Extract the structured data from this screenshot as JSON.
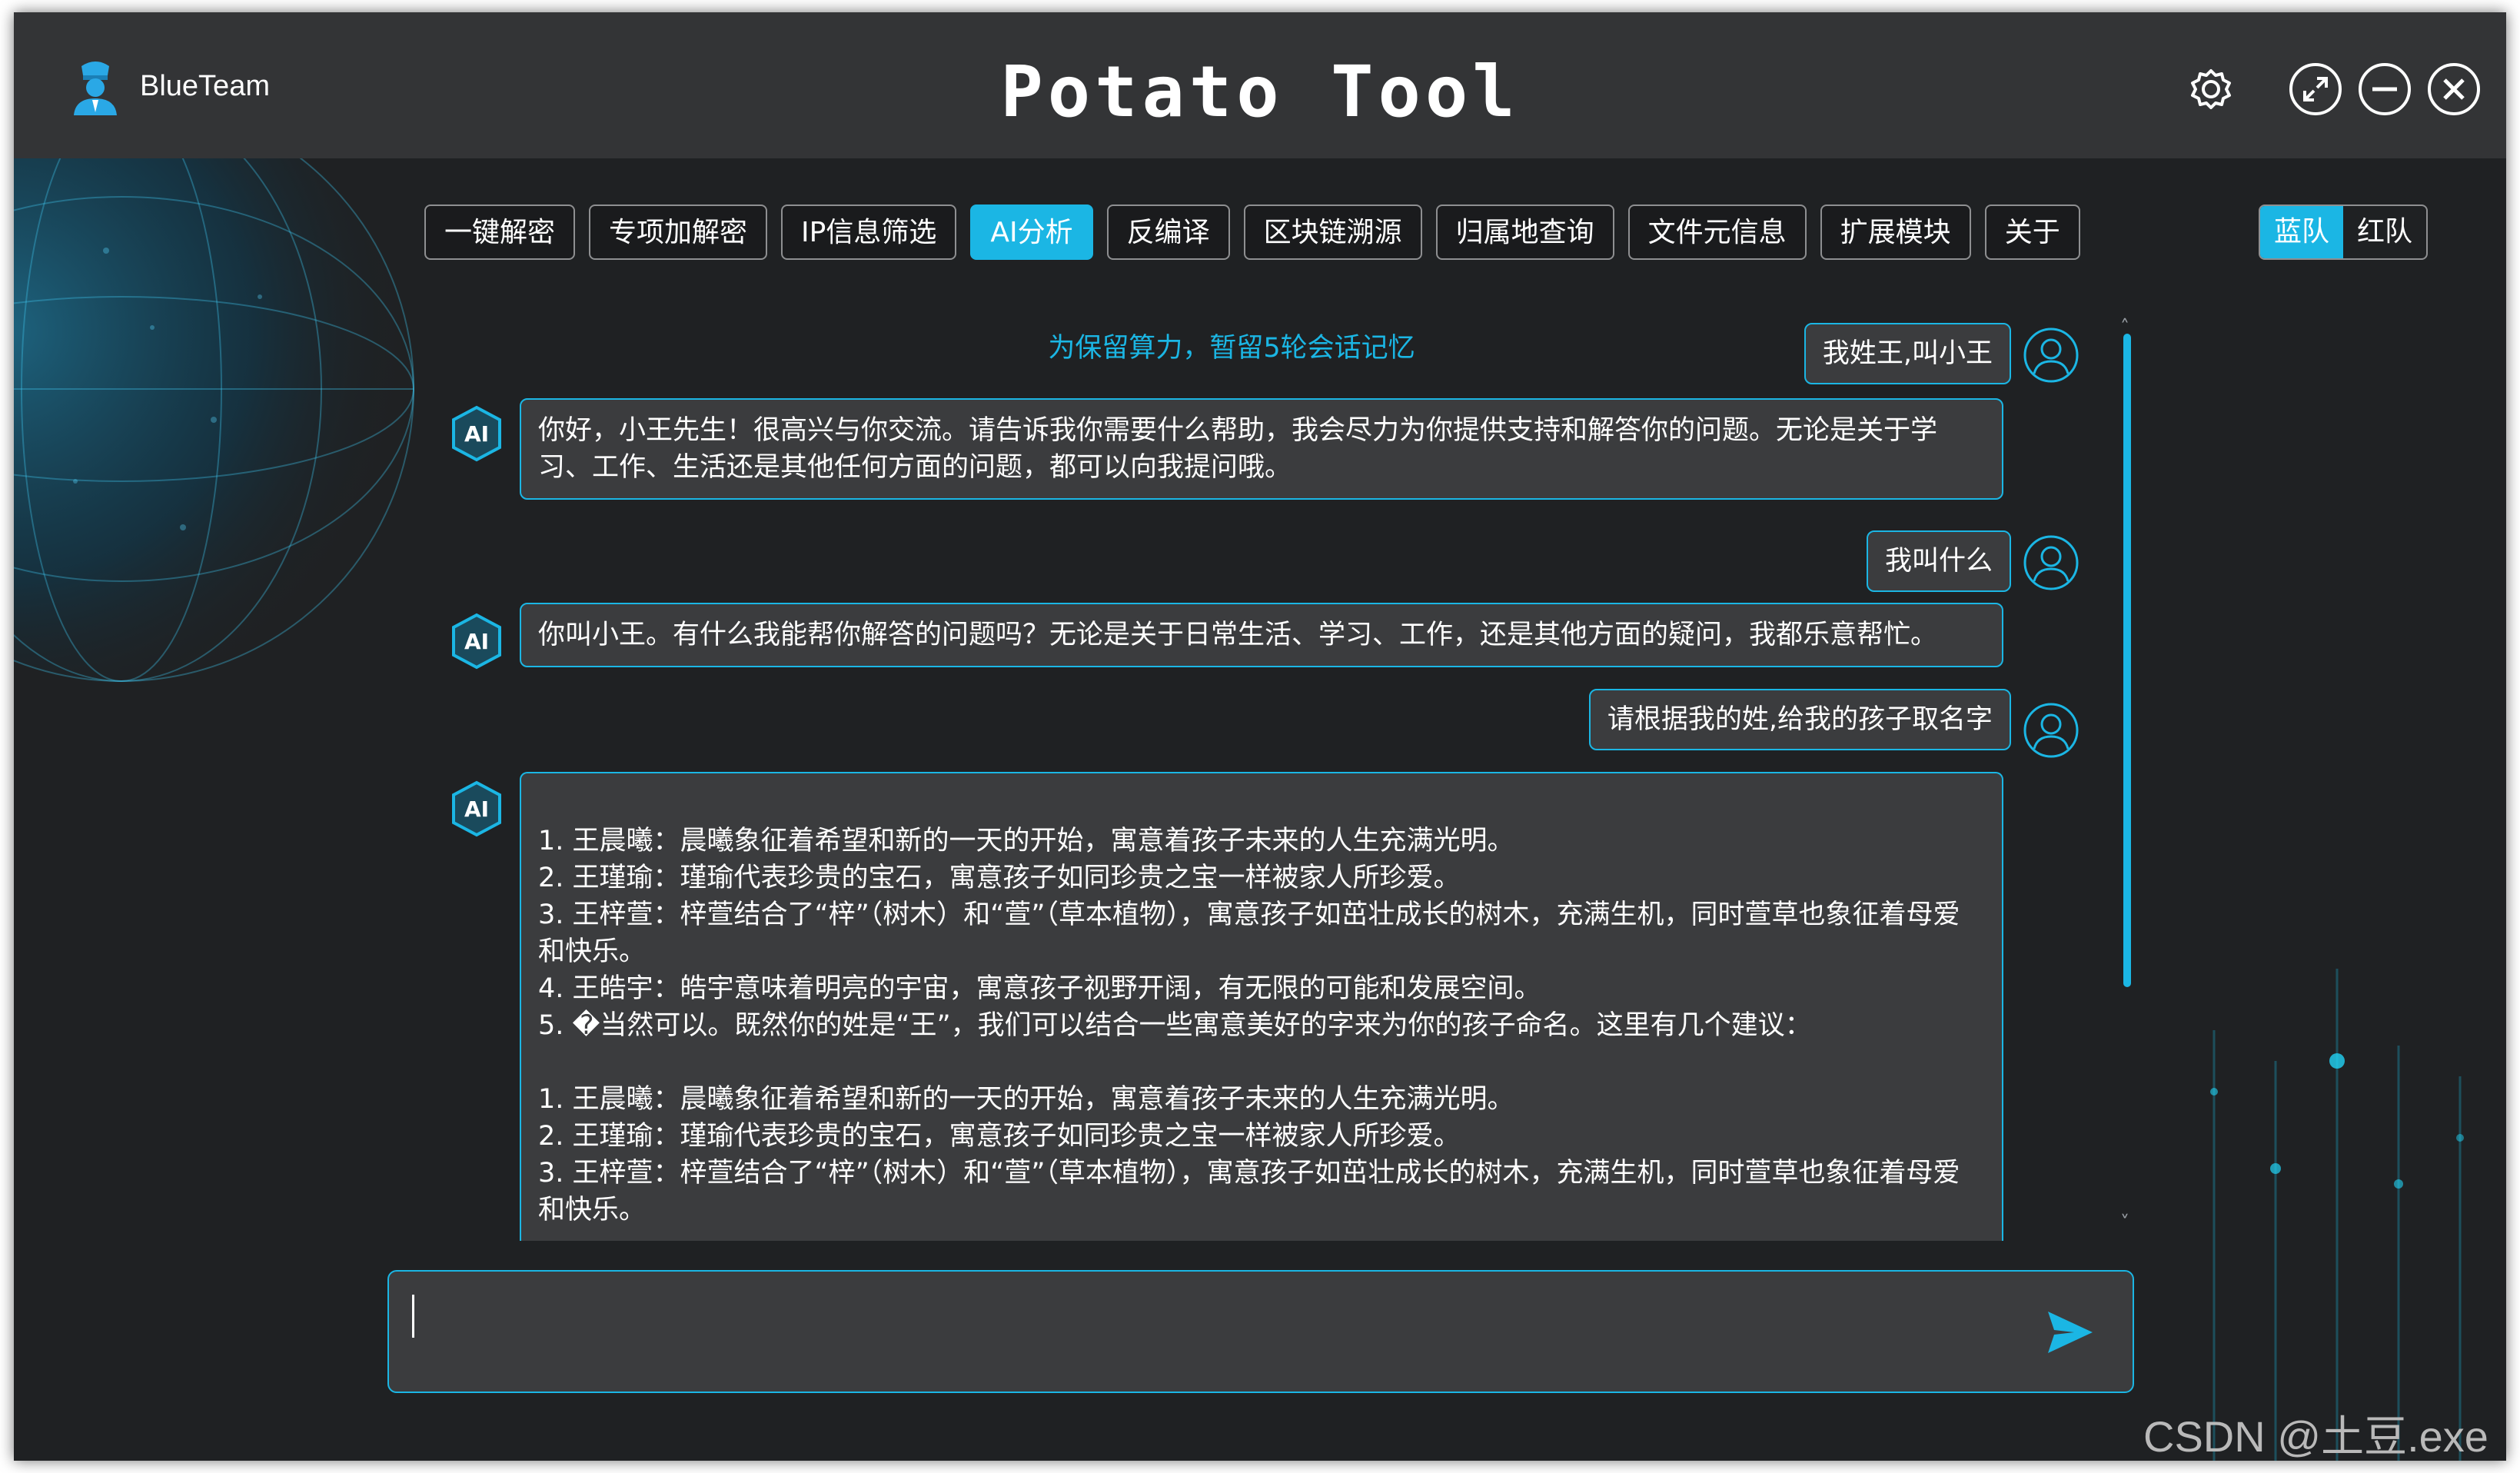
{
  "app": {
    "brand": "BlueTeam",
    "title": "Potato Tool"
  },
  "window_controls": {
    "settings_icon": "gear-icon",
    "maximize_icon": "maximize-icon",
    "minimize_icon": "minimize-icon",
    "close_icon": "close-icon"
  },
  "tabs": [
    {
      "label": "一键解密",
      "active": false
    },
    {
      "label": "专项加解密",
      "active": false
    },
    {
      "label": "IP信息筛选",
      "active": false
    },
    {
      "label": "AI分析",
      "active": true
    },
    {
      "label": "反编译",
      "active": false
    },
    {
      "label": "区块链溯源",
      "active": false
    },
    {
      "label": "归属地查询",
      "active": false
    },
    {
      "label": "文件元信息",
      "active": false
    },
    {
      "label": "扩展模块",
      "active": false
    },
    {
      "label": "关于",
      "active": false
    }
  ],
  "team_toggle": {
    "blue": "蓝队",
    "red": "红队",
    "active": "blue"
  },
  "chat": {
    "notice": "为保留算力，暂留5轮会话记忆",
    "messages": [
      {
        "role": "user",
        "text": "我姓王,叫小王"
      },
      {
        "role": "ai",
        "text": "你好，小王先生！很高兴与你交流。请告诉我你需要什么帮助，我会尽力为你提供支持和解答你的问题。无论是关于学习、工作、生活还是其他任何方面的问题，都可以向我提问哦。"
      },
      {
        "role": "user",
        "text": "我叫什么"
      },
      {
        "role": "ai",
        "text": "你叫小王。有什么我能帮你解答的问题吗？无论是关于日常生活、学习、工作，还是其他方面的疑问，我都乐意帮忙。"
      },
      {
        "role": "user",
        "text": "请根据我的姓,给我的孩子取名字"
      },
      {
        "role": "ai",
        "text": "\n1. 王晨曦：晨曦象征着希望和新的一天的开始，寓意着孩子未来的人生充满光明。\n2. 王瑾瑜：瑾瑜代表珍贵的宝石，寓意孩子如同珍贵之宝一样被家人所珍爱。\n3. 王梓萱：梓萱结合了“梓”（树木）和“萱”（草本植物），寓意孩子如茁壮成长的树木，充满生机，同时萱草也象征着母爱和快乐。\n4. 王皓宇：皓宇意味着明亮的宇宙，寓意孩子视野开阔，有无限的可能和发展空间。\n5. �当然可以。既然你的姓是“王”，我们可以结合一些寓意美好的字来为你的孩子命名。这里有几个建议：\n\n1. 王晨曦：晨曦象征着希望和新的一天的开始，寓意着孩子未来的人生充满光明。\n2. 王瑾瑜：瑾瑜代表珍贵的宝石，寓意孩子如同珍贵之宝一样被家人所珍爱。\n3. 王梓萱：梓萱结合了“梓”（树木）和“萱”（草本植物），寓意孩子如茁壮成长的树木，充满生机，同时萱草也象征着母爱和快乐。"
      }
    ],
    "ai_avatar_label": "AI"
  },
  "input": {
    "placeholder": "",
    "value": "",
    "send_icon": "send-icon"
  },
  "watermark": "CSDN @土豆.exe",
  "colors": {
    "accent": "#1bb6e4",
    "bubble": "#3b3c3e",
    "titlebar": "#333436",
    "background": "#1f2123"
  }
}
